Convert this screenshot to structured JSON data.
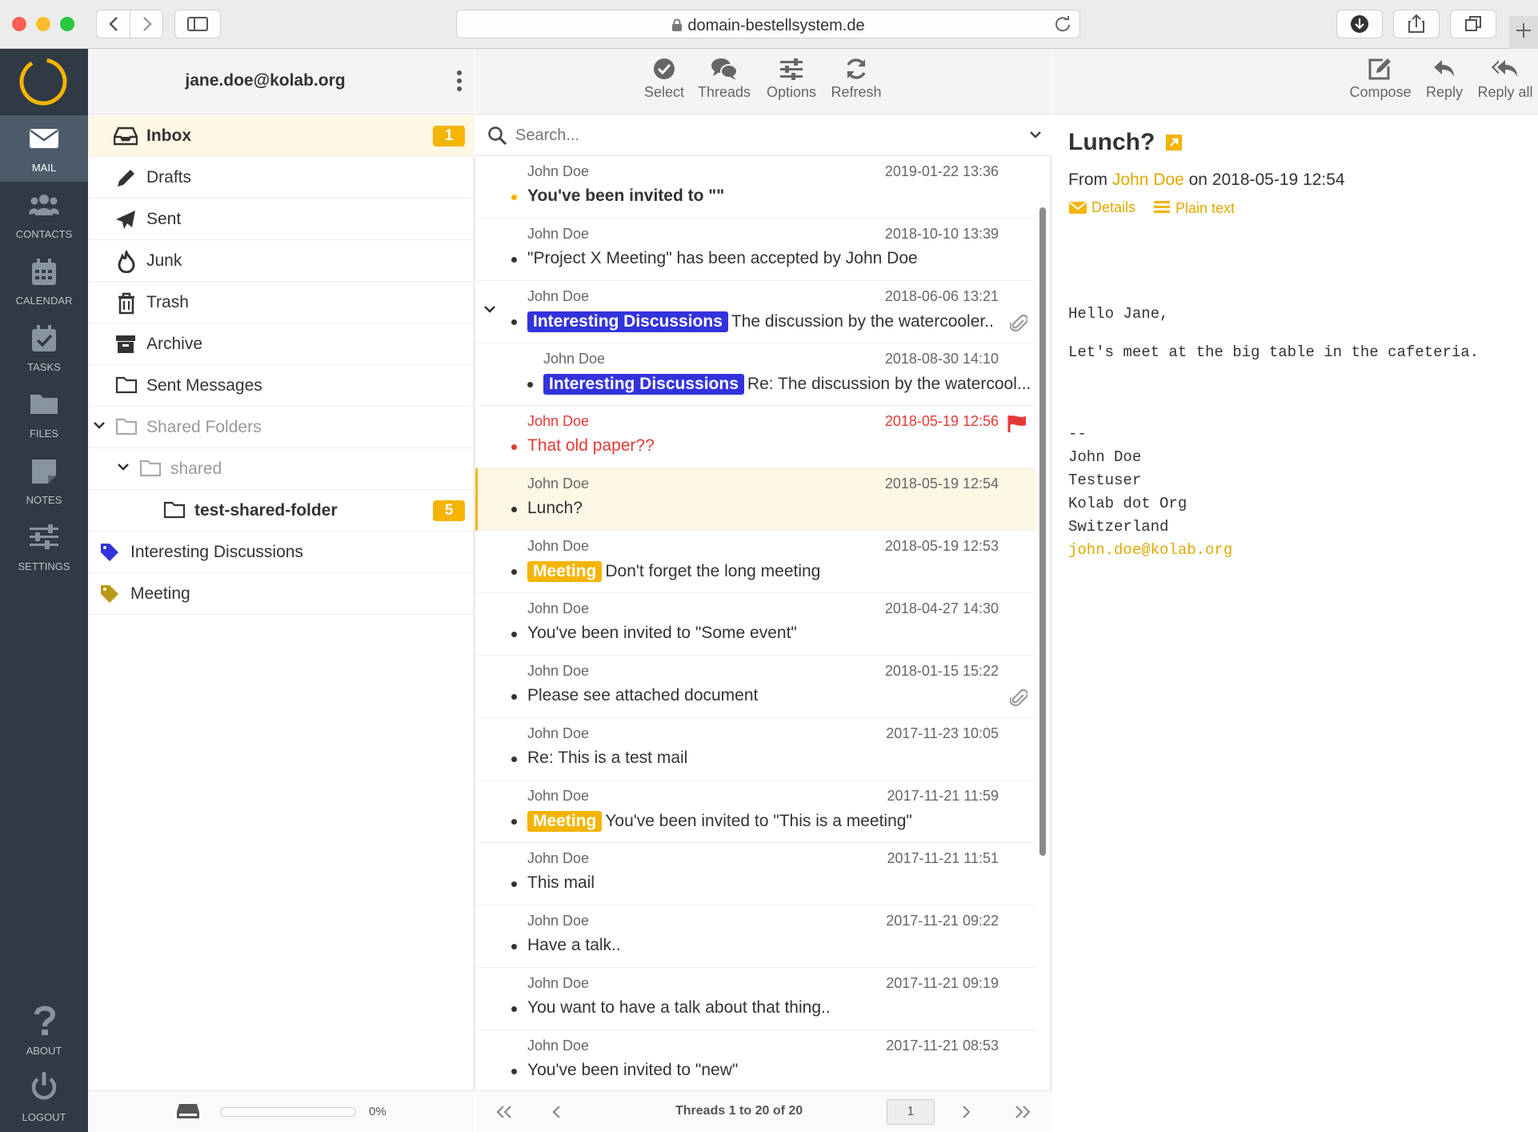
{
  "browser": {
    "url": "domain-bestellsystem.de"
  },
  "sidebar": {
    "items": [
      {
        "label": "MAIL",
        "icon": "mail-icon"
      },
      {
        "label": "CONTACTS",
        "icon": "contacts-icon"
      },
      {
        "label": "CALENDAR",
        "icon": "calendar-icon"
      },
      {
        "label": "TASKS",
        "icon": "tasks-icon"
      },
      {
        "label": "FILES",
        "icon": "folder-icon"
      },
      {
        "label": "NOTES",
        "icon": "notes-icon"
      },
      {
        "label": "SETTINGS",
        "icon": "sliders-icon"
      }
    ],
    "about": "ABOUT",
    "logout": "LOGOUT"
  },
  "folders": {
    "user": "jane.doe@kolab.org",
    "items": [
      {
        "label": "Inbox",
        "badge": "1"
      },
      {
        "label": "Drafts"
      },
      {
        "label": "Sent"
      },
      {
        "label": "Junk"
      },
      {
        "label": "Trash"
      },
      {
        "label": "Archive"
      },
      {
        "label": "Sent Messages"
      },
      {
        "label": "Shared Folders"
      },
      {
        "label": "shared"
      },
      {
        "label": "test-shared-folder",
        "badge": "5"
      },
      {
        "label": "Interesting Discussions"
      },
      {
        "label": "Meeting"
      }
    ],
    "quota": "0%"
  },
  "toolbar": {
    "select": "Select",
    "threads": "Threads",
    "options": "Options",
    "refresh": "Refresh",
    "compose": "Compose",
    "reply": "Reply",
    "reply_all": "Reply all"
  },
  "search": {
    "placeholder": "Search..."
  },
  "tags": {
    "interesting": {
      "label": "Interesting Discussions",
      "color": "#3333dd"
    },
    "meeting": {
      "label": "Meeting",
      "color": "#f4b400"
    }
  },
  "messages": [
    {
      "from": "John Doe",
      "date": "2019-01-22 13:36",
      "subject": "You've been invited to \"\""
    },
    {
      "from": "John Doe",
      "date": "2018-10-10 13:39",
      "subject": "\"Project X Meeting\" has been accepted by John Doe"
    },
    {
      "from": "John Doe",
      "date": "2018-06-06 13:21",
      "subject": "The discussion by the watercooler.."
    },
    {
      "from": "John Doe",
      "date": "2018-08-30 14:10",
      "subject": "Re: The discussion by the watercool..."
    },
    {
      "from": "John Doe",
      "date": "2018-05-19 12:56",
      "subject": "That old paper??"
    },
    {
      "from": "John Doe",
      "date": "2018-05-19 12:54",
      "subject": "Lunch?"
    },
    {
      "from": "John Doe",
      "date": "2018-05-19 12:53",
      "subject": "Don't forget the long meeting"
    },
    {
      "from": "John Doe",
      "date": "2018-04-27 14:30",
      "subject": "You've been invited to \"Some event\""
    },
    {
      "from": "John Doe",
      "date": "2018-01-15 15:22",
      "subject": "Please see attached document"
    },
    {
      "from": "John Doe",
      "date": "2017-11-23 10:05",
      "subject": "Re: This is a test mail"
    },
    {
      "from": "John Doe",
      "date": "2017-11-21 11:59",
      "subject": "You've been invited to \"This is a meeting\""
    },
    {
      "from": "John Doe",
      "date": "2017-11-21 11:51",
      "subject": "This mail"
    },
    {
      "from": "John Doe",
      "date": "2017-11-21 09:22",
      "subject": "Have a talk.."
    },
    {
      "from": "John Doe",
      "date": "2017-11-21 09:19",
      "subject": "You want to have a talk about that thing.."
    },
    {
      "from": "John Doe",
      "date": "2017-11-21 08:53",
      "subject": "You've been invited to \"new\""
    }
  ],
  "pagination": {
    "label": "Threads 1 to 20 of 20",
    "page": "1"
  },
  "preview": {
    "subject": "Lunch?",
    "from_prefix": "From",
    "from_name": "John Doe",
    "date_text": "on 2018-05-19 12:54",
    "details": "Details",
    "plain_text": "Plain text",
    "greeting": "Hello Jane,",
    "body": "Let's meet at the big table in the cafeteria.",
    "sig_sep": "--",
    "sig_name": "John Doe",
    "sig_title": "Testuser",
    "sig_org": "Kolab dot Org",
    "sig_country": "Switzerland",
    "sig_email": "john.doe@kolab.org"
  },
  "colors": {
    "accent": "#f4b400",
    "sidebar": "#2f3a44",
    "flag": "#e53935"
  }
}
